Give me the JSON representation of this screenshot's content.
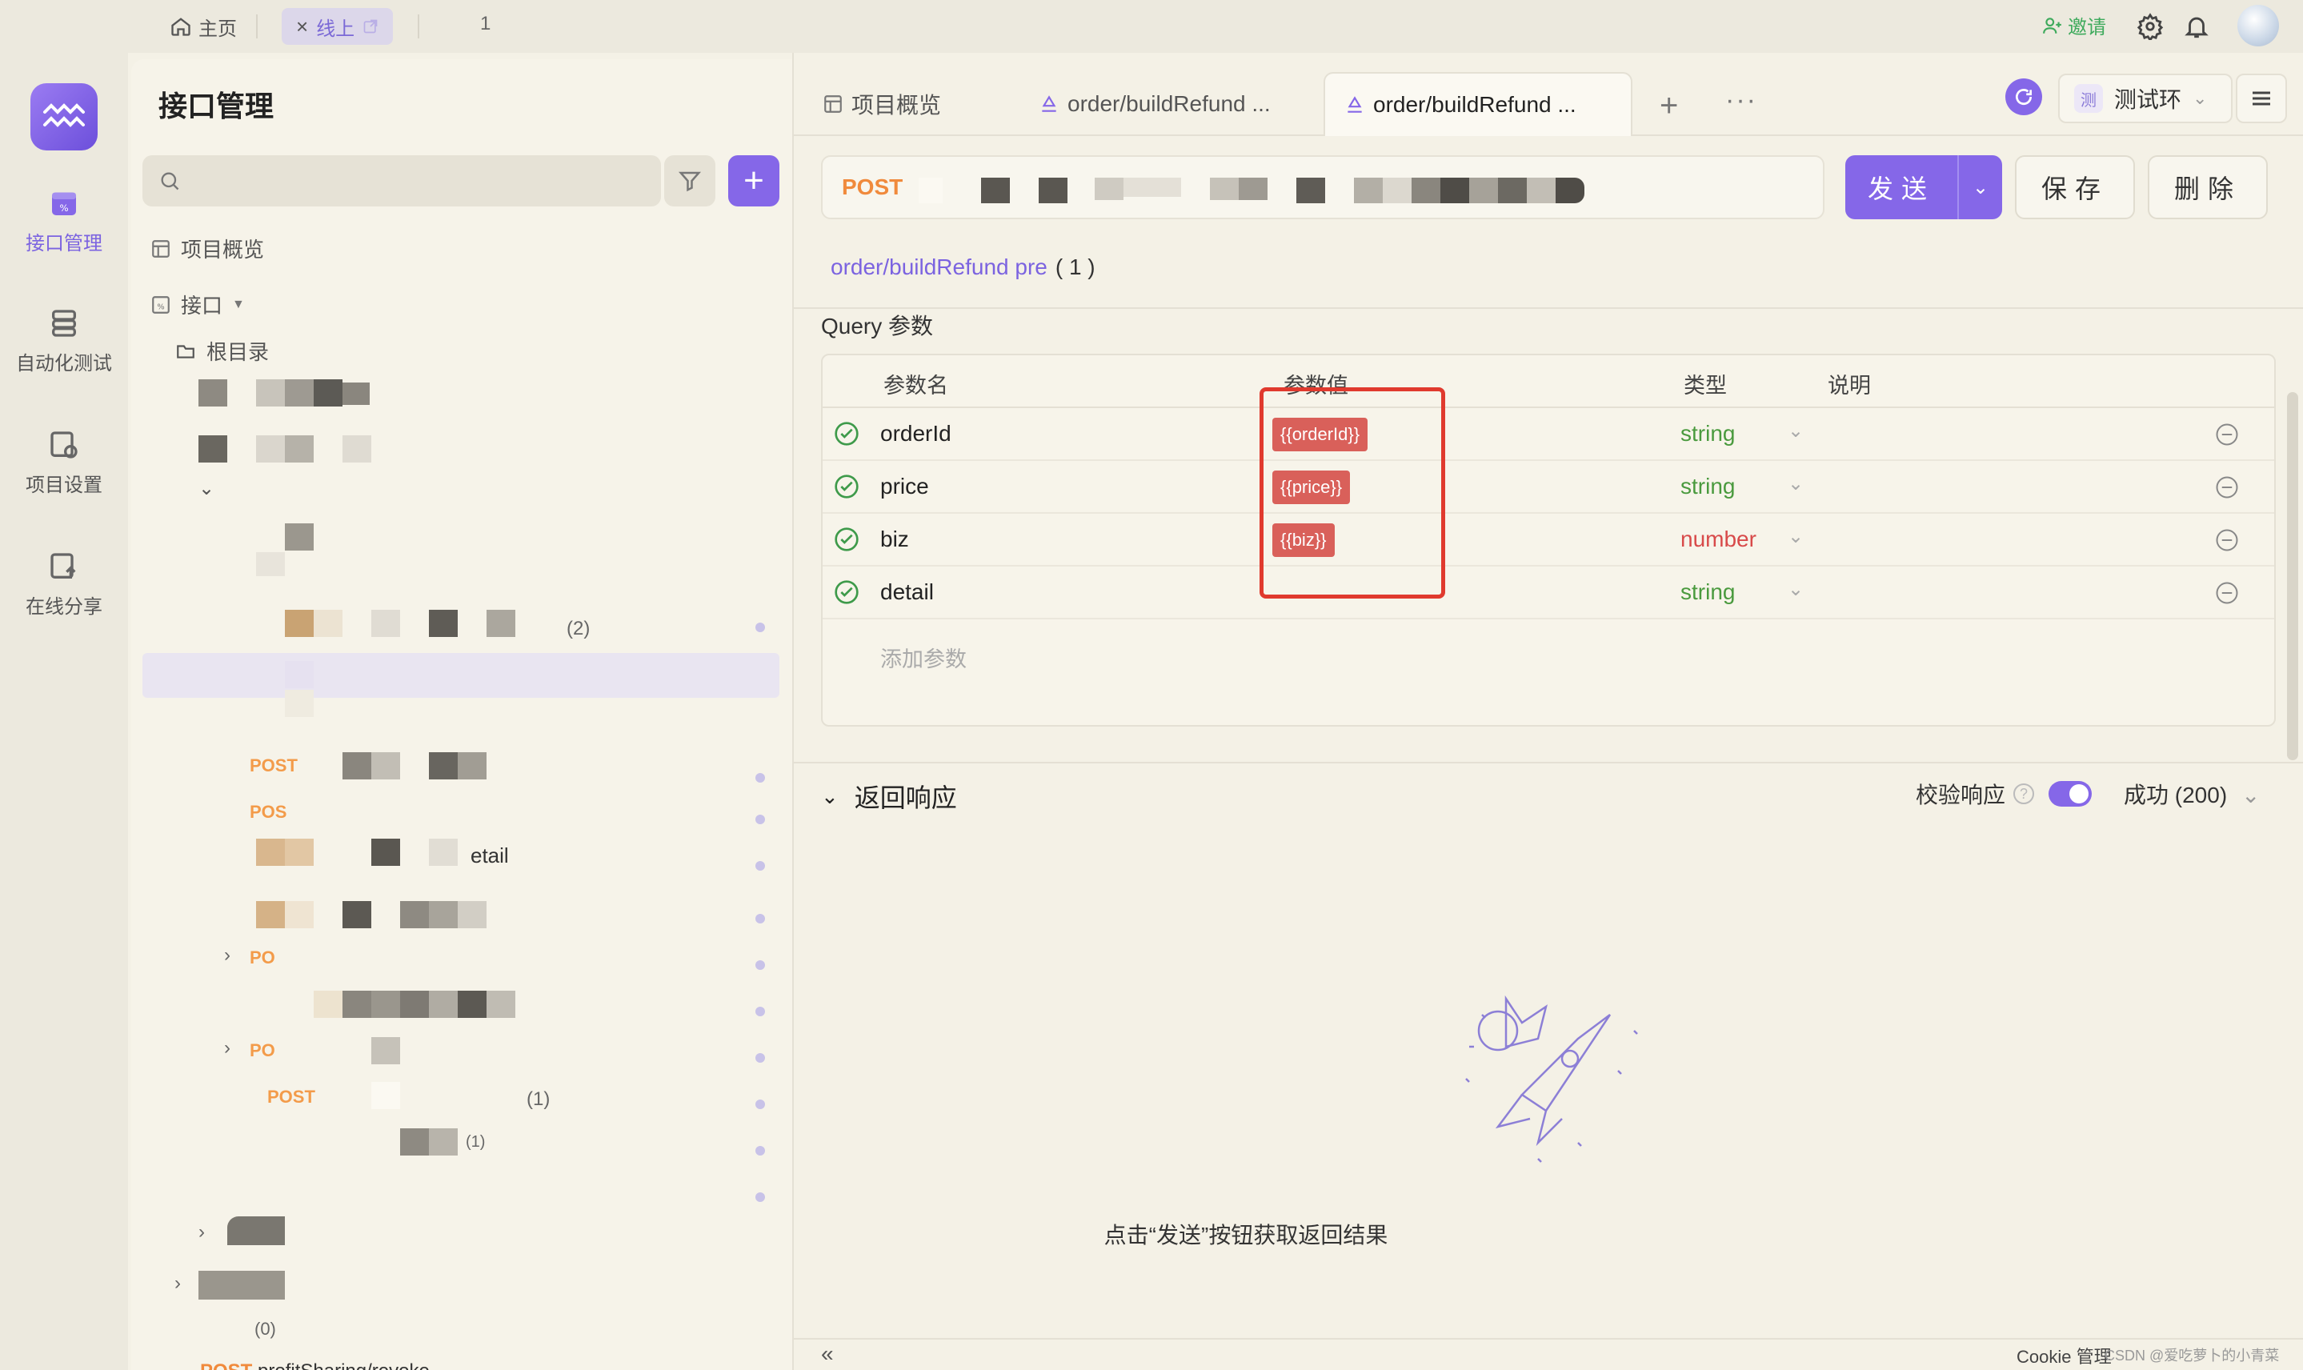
{
  "topbar": {
    "home_label": "主页",
    "online_tab_label": "线上",
    "tab_count": "1",
    "invite_label": "邀请"
  },
  "rail": {
    "items": [
      {
        "label": "接口管理"
      },
      {
        "label": "自动化测试"
      },
      {
        "label": "项目设置"
      },
      {
        "label": "在线分享"
      }
    ]
  },
  "sidebar": {
    "title": "接口管理",
    "overview_label": "项目概览",
    "api_label": "接口",
    "root_label": "根目录",
    "counts": [
      "(2)",
      "(1)",
      "(1)",
      "(0)"
    ],
    "detail_fragment": "etail",
    "post_tags": [
      "POST",
      "POS",
      "PO",
      "PO",
      "POST"
    ],
    "bottom_item": "profitSharing/revoke"
  },
  "tabs": {
    "overview": "项目概览",
    "tab1": "order/buildRefund ...",
    "tab2": "order/buildRefund ..."
  },
  "env": {
    "badge": "测",
    "name": "测试环"
  },
  "request": {
    "method": "POST",
    "send_label": "发送",
    "save_label": "保存",
    "delete_label": "删除"
  },
  "api": {
    "name": "order/buildRefund pre",
    "count": "( 1 )"
  },
  "query": {
    "title": "Query 参数",
    "headers": {
      "name": "参数名",
      "value": "参数值",
      "type": "类型",
      "desc": "说明"
    },
    "rows": [
      {
        "name": "orderId",
        "value": "{{orderId}}",
        "type": "string"
      },
      {
        "name": "price",
        "value": "{{price}}",
        "type": "string"
      },
      {
        "name": "biz",
        "value": "{{biz}}",
        "type": "number"
      },
      {
        "name": "detail",
        "value": "",
        "type": "string"
      }
    ],
    "add_placeholder": "添加参数"
  },
  "response": {
    "title": "返回响应",
    "verify_label": "校验响应",
    "status": "成功 (200)",
    "empty_hint": "点击“发送”按钮获取返回结果"
  },
  "footer": {
    "collapse": "«",
    "cookie": "Cookie 管理"
  },
  "watermark": "CSDN @爱吃萝卜的小青菜",
  "colors": {
    "accent": "#8567e8",
    "string_type": "#4a9a3e",
    "number_type": "#d84a4a",
    "variable_tag": "#d9605a",
    "highlight_box": "#e03a2e"
  }
}
